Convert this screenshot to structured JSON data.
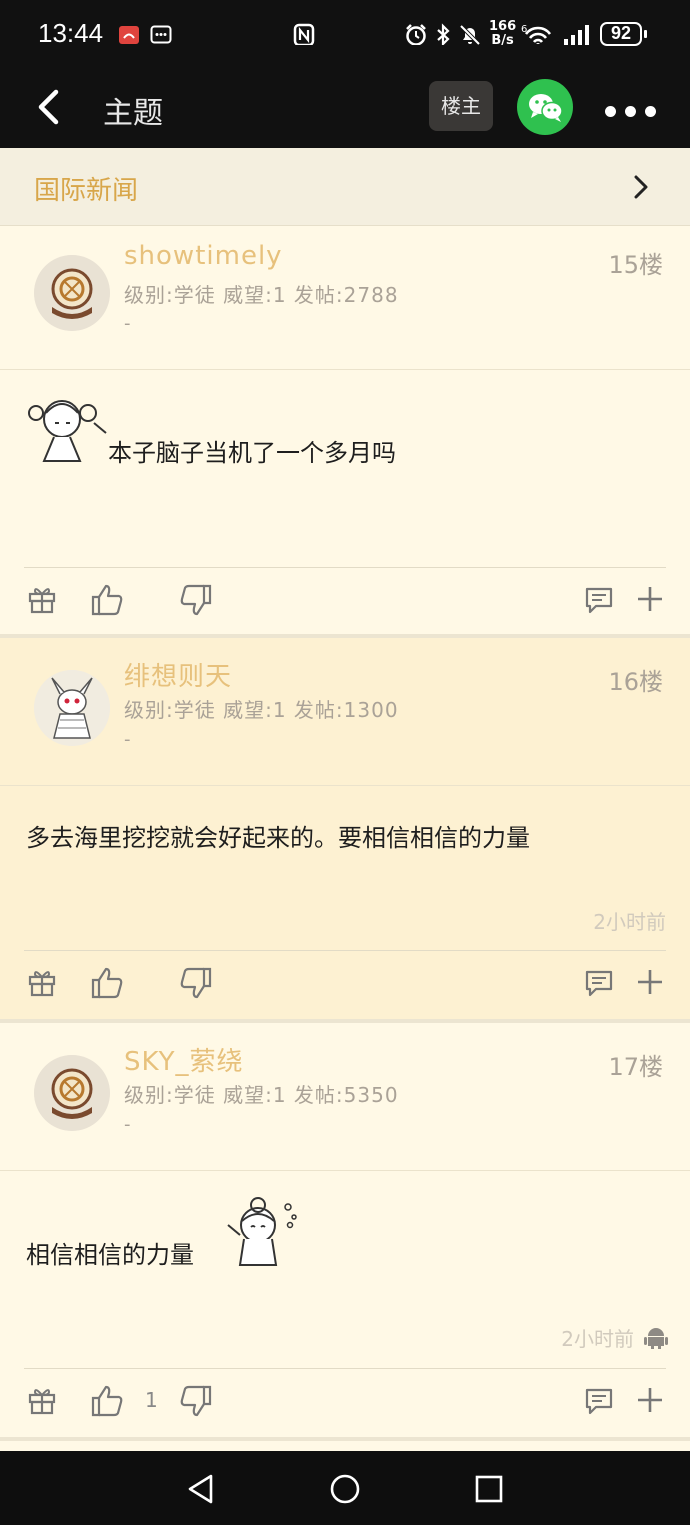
{
  "status": {
    "time": "13:44",
    "net_speed_top": "166",
    "net_speed_bottom": "B/s",
    "battery": "92"
  },
  "appbar": {
    "title": "主题",
    "op_button": "楼主"
  },
  "category": {
    "name": "国际新闻"
  },
  "posts": [
    {
      "username": "showtimely",
      "meta": "级别:学徒 威望:1 发帖:2788",
      "signature": "-",
      "floor": "15楼",
      "content": "本子脑子当机了一个多月吗",
      "time": "",
      "likes": ""
    },
    {
      "username": "绯想则天",
      "meta": "级别:学徒 威望:1 发帖:1300",
      "signature": "-",
      "floor": "16楼",
      "content": "多去海里挖挖就会好起来的。要相信相信的力量",
      "time": "2小时前",
      "likes": ""
    },
    {
      "username": "SKY_萦绕",
      "meta": "级别:学徒 威望:1 发帖:5350",
      "signature": "-",
      "floor": "17楼",
      "content": "相信相信的力量",
      "time": "2小时前",
      "likes": "1"
    }
  ],
  "icons": [
    "back-icon",
    "wechat-icon",
    "more-icon",
    "chevron-right-icon",
    "gift-icon",
    "thumb-up-icon",
    "thumb-down-icon",
    "comment-icon",
    "plus-icon",
    "android-icon",
    "nav-back-icon",
    "nav-home-icon",
    "nav-recents-icon"
  ],
  "colors": {
    "accent": "#d8a64a",
    "username": "#e7c17c",
    "background": "#fff9e6",
    "wechat": "#2fc14f"
  }
}
